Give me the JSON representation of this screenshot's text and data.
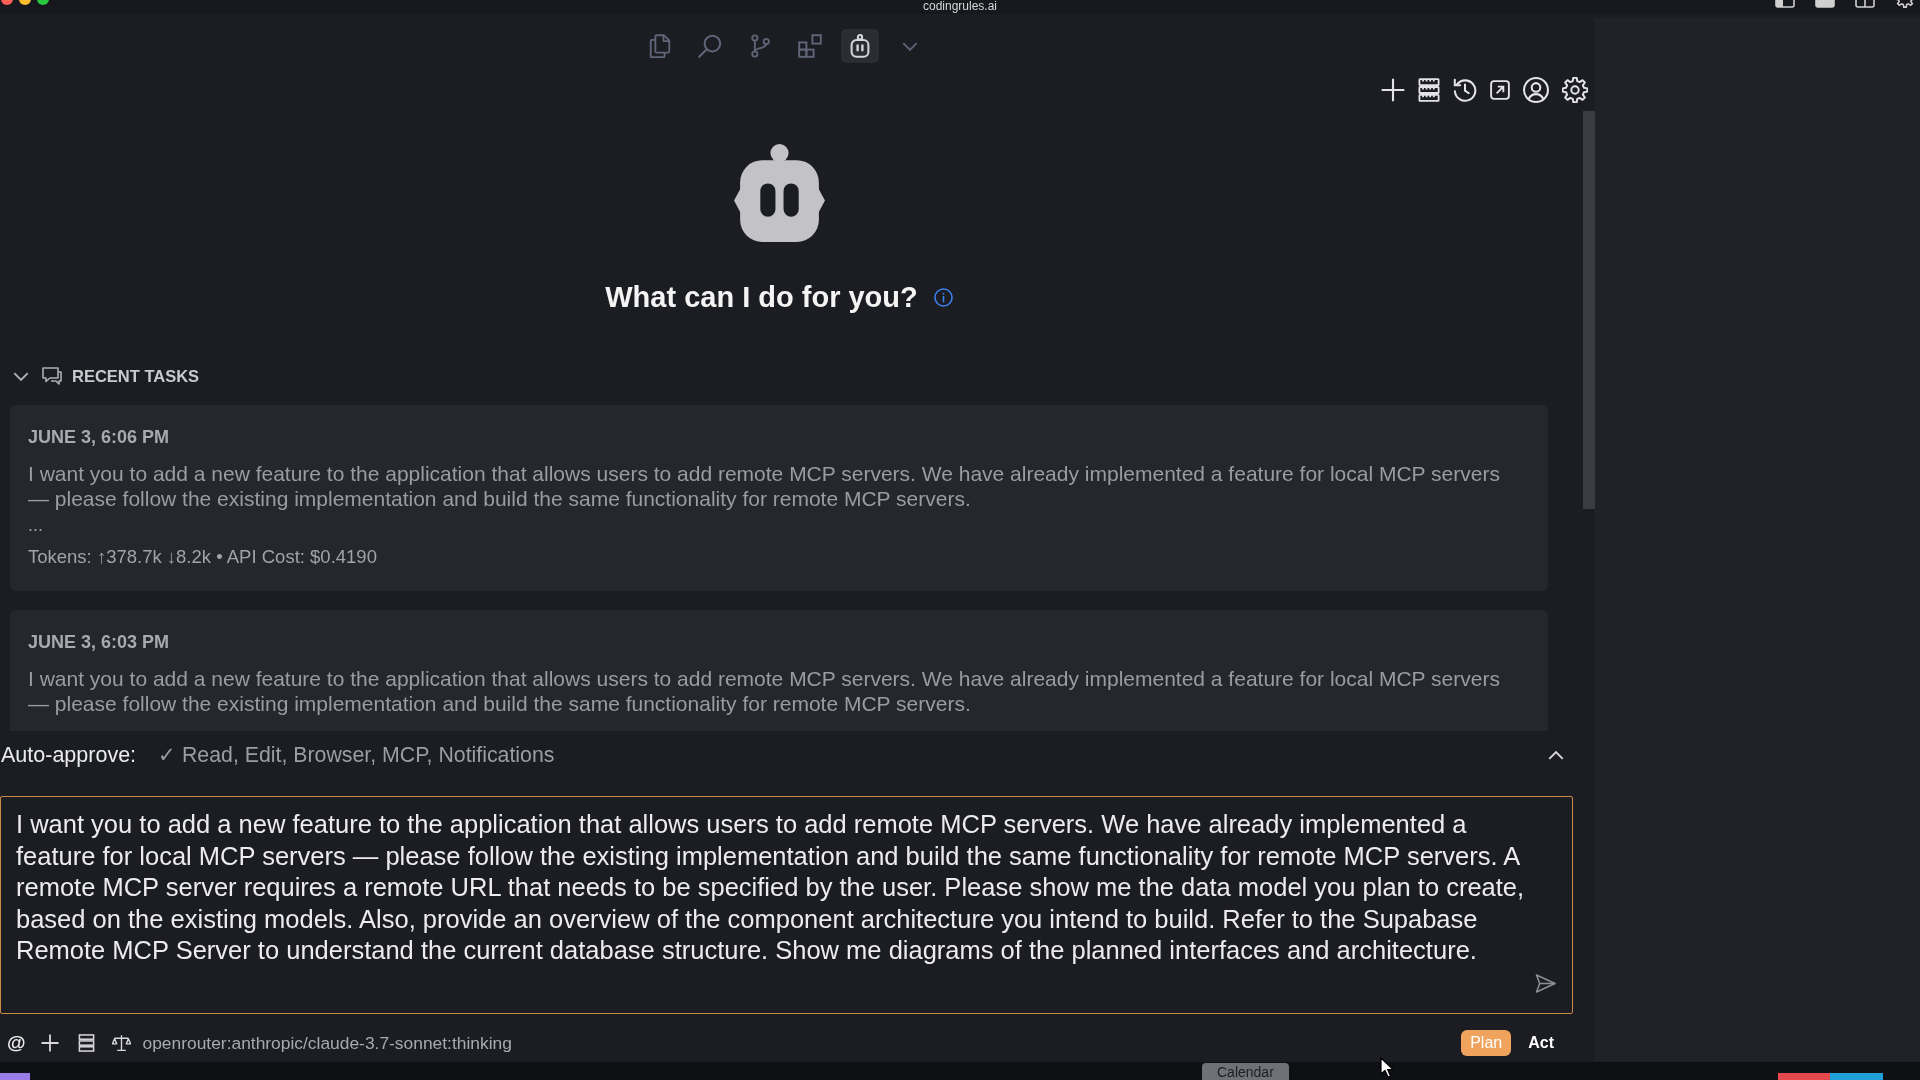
{
  "window": {
    "title": "codingrules.ai"
  },
  "view_tabs": [
    {
      "selected": false
    },
    {
      "selected": false
    },
    {
      "selected": false
    },
    {
      "selected": false
    },
    {
      "selected": true
    }
  ],
  "welcome": {
    "title": "What can I do for you?"
  },
  "recent_tasks": {
    "heading": "RECENT TASKS",
    "expanded": true,
    "items": [
      {
        "date": "JUNE 3, 6:06 PM",
        "text": "I want you to add a new feature to the application that allows users to add remote MCP servers. We have already implemented a feature for local MCP servers — please follow the existing implementation and build the same functionality for remote MCP servers.",
        "more": "...",
        "usage": "Tokens: ↑378.7k ↓8.2k • API Cost: $0.4190"
      },
      {
        "date": "JUNE 3, 6:03 PM",
        "text": "I want you to add a new feature to the application that allows users to add remote MCP servers. We have already implemented a feature for local MCP servers — please follow the existing implementation and build the same functionality for remote MCP servers."
      }
    ]
  },
  "auto_approve": {
    "label": "Auto-approve:",
    "value": "✓ Read, Edit, Browser, MCP, Notifications",
    "expanded": false
  },
  "input": {
    "value": "I want you to add a new feature to the application that allows users to add remote MCP servers. We have already implemented a feature for local MCP servers — please follow the existing implementation and build the same functionality for remote MCP servers. A remote MCP server requires a remote URL that needs to be specified by the user. Please show me the data model you plan to create, based on the existing models. Also, provide an overview of the component architecture you intend to build. Refer to the Supabase Remote MCP Server to understand the current database structure. Show me diagrams of the planned interfaces and architecture."
  },
  "footer": {
    "mention": "@",
    "model": "openrouter:anthropic/claude-3.7-sonnet:thinking",
    "modes": [
      {
        "label": "Plan",
        "selected": true
      },
      {
        "label": "Act",
        "selected": false
      }
    ]
  },
  "dock": {
    "tooltip": "Calendar"
  }
}
